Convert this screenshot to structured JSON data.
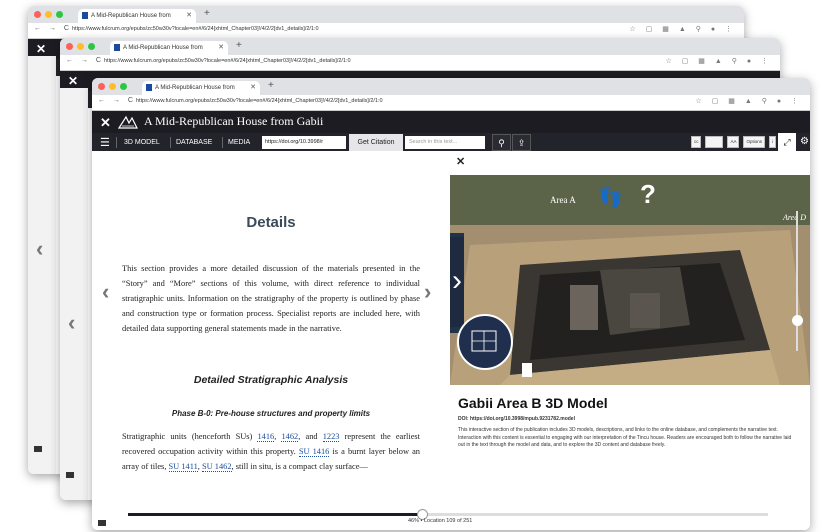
{
  "browser": {
    "tab_title": "A Mid-Republican House from",
    "url_back": "https://www.fulcrum.org/epubs/zc50w30v?locale=en#/6/24[xhtml_Chapter03]!/4/2/2[dv1_details]/2/1:0",
    "url_mid": "https://www.fulcrum.org/epubs/zc50w30v?locale=en#/6/24[xhtml_Chapter03]!/4/2/2[dv1_details]/2/1:0",
    "url_front": "https://www.fulcrum.org/epubs/zc50w30v?locale=en#/6/24[xhtml_Chapter03]!/4/2/2[dv1_details]/2/1:0",
    "new_tab": "+",
    "nav_glyphs": "← → C",
    "colors": {
      "close": "#ff5f57",
      "minimize": "#febc2e",
      "zoom": "#28c840"
    }
  },
  "app": {
    "title": "A Mid-Republican House from Gabii",
    "menu": [
      "3D MODEL",
      "DATABASE",
      "MEDIA"
    ],
    "doi_value": "https://doi.org/10.3998/r",
    "get_citation": "Get Citation",
    "search_placeholder": "Search in this text...",
    "tools": [
      "cc",
      "AA",
      "Options",
      "i"
    ]
  },
  "content": {
    "heading": "Details",
    "intro": "This section provides a more detailed discussion of the materials presented in the “Story” and “More” sections of this volume, with direct reference to individual stratigraphic units. Information on the stratigraphy of the property is outlined by phase and construction type or formation process. Specialist reports are included here, with detailed data supporting general statements made in the narrative.",
    "section_title": "Detailed Stratigraphic Analysis",
    "phase_title": "Phase B-0: Pre-house structures and property limits",
    "strat": {
      "t1": "Stratigraphic units (henceforth SUs) ",
      "su1": "1416",
      "t2": ", ",
      "su2": "1462",
      "t3": ", and ",
      "su3": "1223",
      "t4": " represent the earliest recovered occupation activity within this property. ",
      "su4": "SU 1416",
      "t5": " is a burnt layer below an array of tiles, ",
      "su5": "SU 1411",
      "t6": ", ",
      "su6": "SU 1462",
      "t7": ", still in situ, is a compact clay surface—"
    }
  },
  "model": {
    "labels": [
      "Area A",
      "Area D"
    ],
    "question": "?",
    "title": "Gabii Area B 3D Model",
    "doi": "DOI: https://doi.org/10.3998/mpub.9231782.model",
    "description": "This interactive section of the publication includes 3D models, descriptions, and links to the online database, and complements the narrative text. Interaction with this content is essential to engaging with our interpretation of the Tincu house. Readers are encouraged both to follow the narrative laid out in the text through the model and data, and to explore the 3D content and database freely."
  },
  "footer": {
    "location": "46% • Location 109 of 251",
    "progress": 0.46
  }
}
